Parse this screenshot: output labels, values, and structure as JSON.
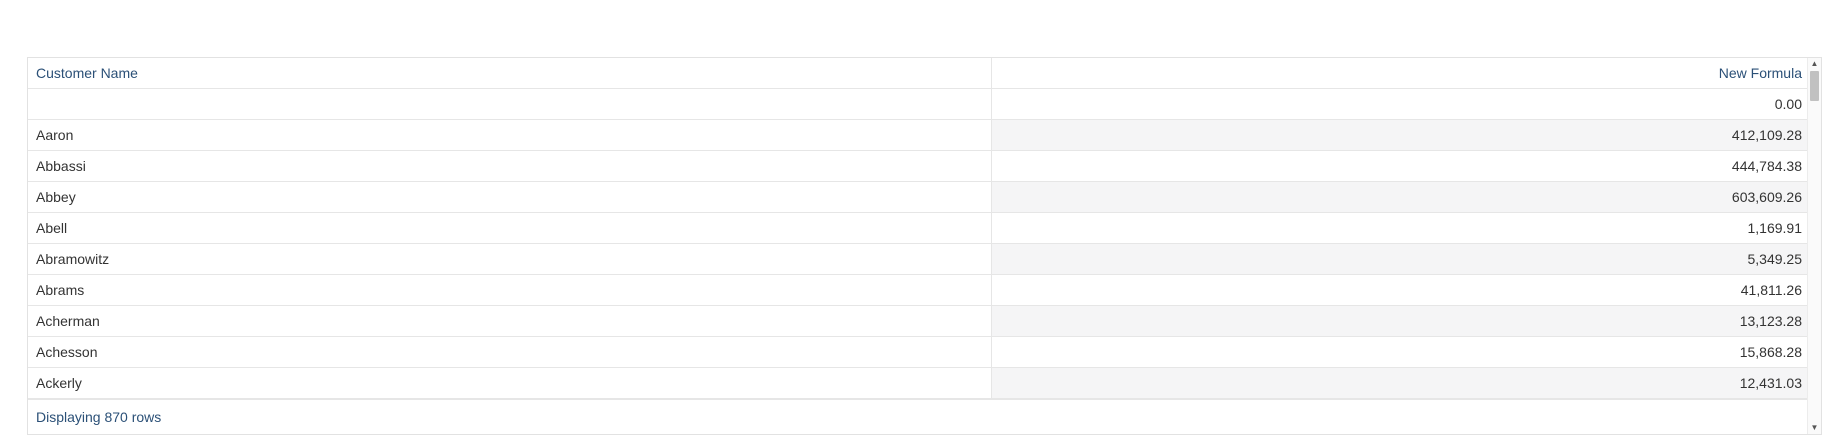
{
  "table": {
    "columns": [
      "Customer Name",
      "New Formula"
    ],
    "rows": [
      {
        "name": "",
        "value": "0.00"
      },
      {
        "name": "Aaron",
        "value": "412,109.28"
      },
      {
        "name": "Abbassi",
        "value": "444,784.38"
      },
      {
        "name": "Abbey",
        "value": "603,609.26"
      },
      {
        "name": "Abell",
        "value": "1,169.91"
      },
      {
        "name": "Abramowitz",
        "value": "5,349.25"
      },
      {
        "name": "Abrams",
        "value": "41,811.26"
      },
      {
        "name": "Acherman",
        "value": "13,123.28"
      },
      {
        "name": "Achesson",
        "value": "15,868.28"
      },
      {
        "name": "Ackerly",
        "value": "12,431.03"
      }
    ],
    "footer": "Displaying 870 rows"
  },
  "colors": {
    "header_text": "#2b5077",
    "body_text": "#333333",
    "alt_row": "#f5f5f6",
    "border": "#e6e6e6"
  },
  "icons": {
    "scroll_up": "triangle-up-icon",
    "scroll_down": "triangle-down-icon"
  }
}
